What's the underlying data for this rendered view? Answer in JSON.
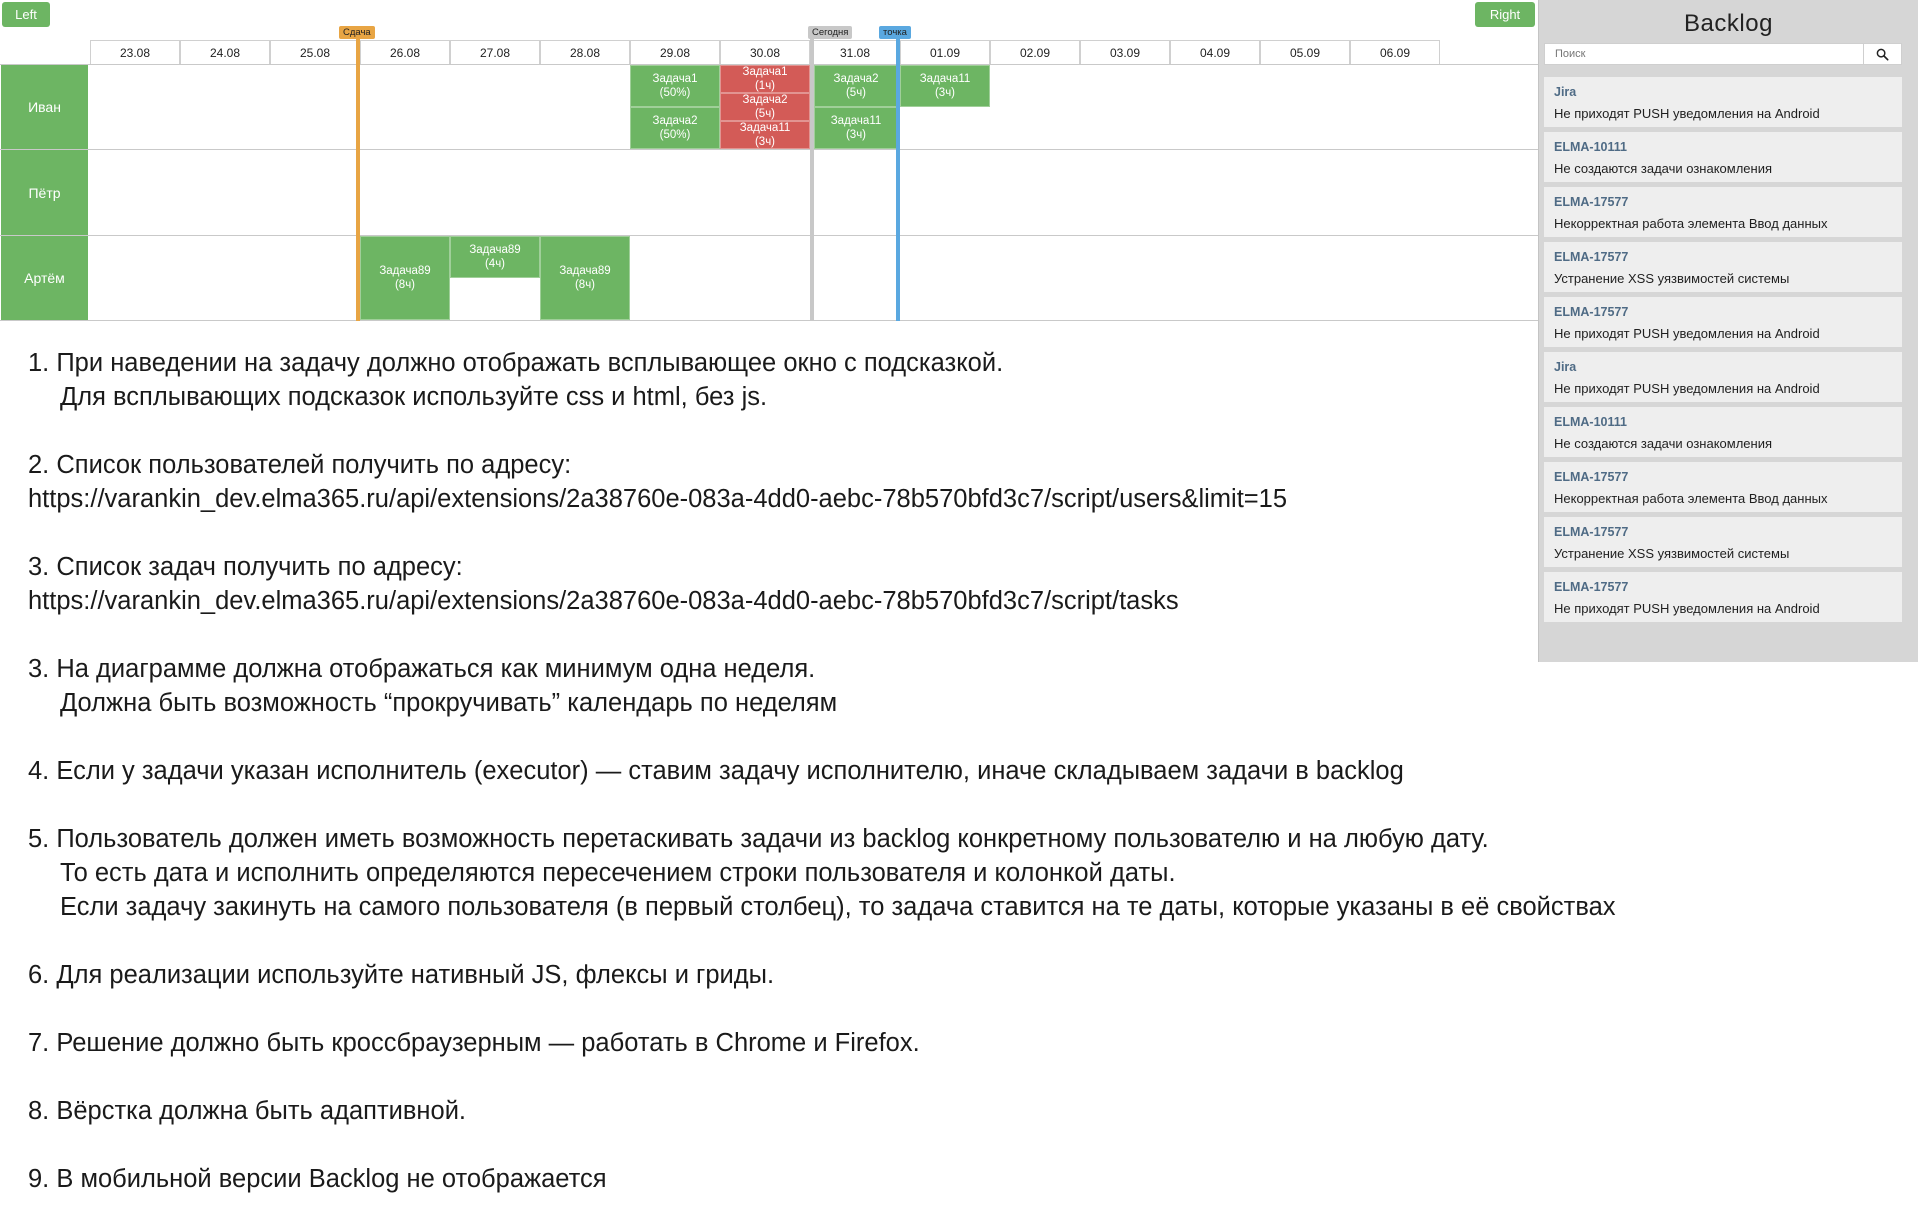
{
  "gantt": {
    "btn_left": "Left",
    "btn_right": "Right",
    "dates": [
      "23.08",
      "24.08",
      "25.08",
      "26.08",
      "27.08",
      "28.08",
      "29.08",
      "30.08",
      "31.08",
      "01.09",
      "02.09",
      "03.09",
      "04.09",
      "05.09",
      "06.09"
    ],
    "users": [
      "Иван",
      "Пётр",
      "Артём"
    ],
    "markers": {
      "deadline": "Сдача",
      "today": "Сегодня",
      "point": "точка"
    },
    "tasks": [
      {
        "name": "Задача1",
        "detail": "(50%)",
        "color": "green"
      },
      {
        "name": "Задача2",
        "detail": "(50%)",
        "color": "green"
      },
      {
        "name": "Задача1",
        "detail": "(1ч)",
        "color": "red"
      },
      {
        "name": "Задача2",
        "detail": "(5ч)",
        "color": "red"
      },
      {
        "name": "Задача11",
        "detail": "(3ч)",
        "color": "red"
      },
      {
        "name": "Задача2",
        "detail": "(5ч)",
        "color": "green"
      },
      {
        "name": "Задача11",
        "detail": "(3ч)",
        "color": "green"
      },
      {
        "name": "Задача11",
        "detail": "(3ч)",
        "color": "green"
      },
      {
        "name": "Задача89",
        "detail": "(8ч)",
        "color": "green"
      },
      {
        "name": "Задача89",
        "detail": "(4ч)",
        "color": "green"
      },
      {
        "name": "Задача89",
        "detail": "(8ч)",
        "color": "green"
      }
    ],
    "colors": {
      "green": "#6db563",
      "red": "#d35b57",
      "orange": "#e8a544",
      "gray": "#c8c8c8",
      "blue": "#5aa8e0"
    }
  },
  "backlog": {
    "title": "Backlog",
    "search_placeholder": "Поиск",
    "items": [
      {
        "key": "Jira",
        "text": "Не приходят PUSH уведомления на Android"
      },
      {
        "key": "ELMA-10111",
        "text": "Не создаются задачи ознакомления"
      },
      {
        "key": "ELMA-17577",
        "text": "Некорректная работа элемента Ввод данных"
      },
      {
        "key": "ELMA-17577",
        "text": "Устранение XSS уязвимостей системы"
      },
      {
        "key": "ELMA-17577",
        "text": "Не приходят PUSH уведомления на Android"
      },
      {
        "key": "Jira",
        "text": "Не приходят PUSH уведомления на Android"
      },
      {
        "key": "ELMA-10111",
        "text": "Не создаются задачи ознакомления"
      },
      {
        "key": "ELMA-17577",
        "text": "Некорректная работа элемента Ввод данных"
      },
      {
        "key": "ELMA-17577",
        "text": "Устранение XSS уязвимостей системы"
      },
      {
        "key": "ELMA-17577",
        "text": "Не приходят PUSH уведомления на Android"
      }
    ]
  },
  "requirements": [
    {
      "lines": [
        "1. При наведении на задачу должно отображать всплывающее окно с подсказкой.",
        "Для всплывающих подсказок используйте css и html, без js."
      ]
    },
    {
      "lines": [
        "2. Список пользователей получить по адресу:",
        "https://varankin_dev.elma365.ru/api/extensions/2a38760e-083a-4dd0-aebc-78b570bfd3c7/script/users&limit=15"
      ]
    },
    {
      "lines": [
        "3. Список задач получить по адресу:",
        "https://varankin_dev.elma365.ru/api/extensions/2a38760e-083a-4dd0-aebc-78b570bfd3c7/script/tasks"
      ]
    },
    {
      "lines": [
        "3. На диаграмме должна отображаться как минимум одна неделя.",
        "Должна быть возможность “прокручивать” календарь по неделям"
      ]
    },
    {
      "lines": [
        "4. Если у задачи указан исполнитель (executor) — ставим задачу исполнителю, иначе складываем задачи в backlog"
      ]
    },
    {
      "lines": [
        "5. Пользователь должен иметь возможность перетаскивать задачи из backlog конкретному пользователю и на любую дату.",
        "То есть дата и исполнить определяются пересечением строки пользователя и колонкой даты.",
        "Если задачу закинуть на самого пользователя (в первый столбец), то задача ставится на те даты, которые указаны в её свойствах"
      ]
    },
    {
      "lines": [
        "6. Для реализации используйте нативный JS, флексы и гриды."
      ]
    },
    {
      "lines": [
        "7. Решение должно быть кроссбраузерным — работать в Chrome и Firefox."
      ]
    },
    {
      "lines": [
        "8. Вёрстка должна быть адаптивной."
      ]
    },
    {
      "lines": [
        "9. В мобильной версии Backlog не отображается"
      ]
    }
  ]
}
